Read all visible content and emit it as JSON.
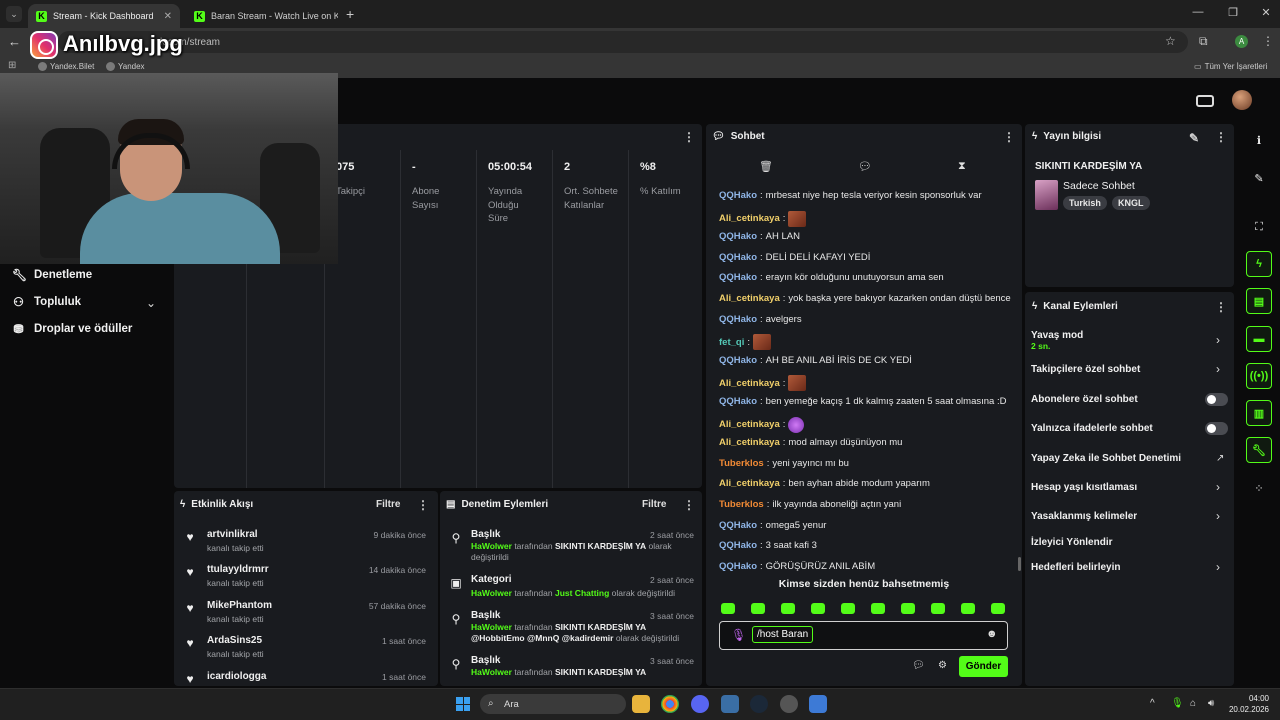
{
  "browser": {
    "tabs": [
      {
        "title": "Stream - Kick Dashboard",
        "active": true
      },
      {
        "title": "Baran Stream - Watch Live on K",
        "active": false
      }
    ],
    "url": "k.com/stream",
    "bookmarks": [
      "Yandex.Bilet",
      "Yandex"
    ],
    "all_bookmarks": "Tüm Yer İşaretleri",
    "profile_initial": "A"
  },
  "overlay": {
    "watermark": "Anılbvg.jpg"
  },
  "nav": {
    "items": [
      {
        "label": "Denetleme",
        "icon": "wrench-icon"
      },
      {
        "label": "Topluluk",
        "icon": "community-icon"
      },
      {
        "label": "Droplar ve ödüller",
        "icon": "gift-icon"
      }
    ]
  },
  "stats": [
    {
      "value": "075",
      "label": "Takipçi"
    },
    {
      "value": "-",
      "label": "Abone Sayısı"
    },
    {
      "value": "05:00:54",
      "label": "Yayında Olduğu Süre"
    },
    {
      "value": "2",
      "label": "Ort. Sohbete Katılanlar"
    },
    {
      "value": "%8",
      "label": "% Katılım"
    }
  ],
  "activity": {
    "title": "Etkinlik Akışı",
    "filter": "Filtre",
    "items": [
      {
        "name": "artvinlikral",
        "sub": "kanalı takip etti",
        "time": "9 dakika önce"
      },
      {
        "name": "ttulayyldrmrr",
        "sub": "kanalı takip etti",
        "time": "14 dakika önce"
      },
      {
        "name": "MikePhantom",
        "sub": "kanalı takip etti",
        "time": "57 dakika önce"
      },
      {
        "name": "ArdaSins25",
        "sub": "kanalı takip etti",
        "time": "1 saat önce"
      },
      {
        "name": "icardiologga",
        "sub": "",
        "time": "1 saat önce"
      }
    ]
  },
  "moderation": {
    "title": "Denetim Eylemleri",
    "filter": "Filtre",
    "items": [
      {
        "title": "Başlık",
        "time": "2 saat önce",
        "user": "HaWolwer",
        "mid": "tarafından",
        "value": "SIKINTI KARDEŞİM YA",
        "end": "olarak değiştirildi"
      },
      {
        "title": "Kategori",
        "time": "2 saat önce",
        "user": "HaWolwer",
        "mid": "tarafından",
        "value": "Just Chatting",
        "end": "olarak değiştirildi"
      },
      {
        "title": "Başlık",
        "time": "3 saat önce",
        "user": "HaWolwer",
        "mid": "tarafından",
        "value": "SIKINTI KARDEŞİM YA @HobbitEmo @MnnQ @kadirdemir",
        "end": "olarak değiştirildi"
      },
      {
        "title": "Başlık",
        "time": "3 saat önce",
        "user": "HaWolwer",
        "mid": "tarafından",
        "value": "SIKINTI KARDEŞİM YA",
        "end": ""
      }
    ]
  },
  "chat": {
    "title": "Sohbet",
    "messages": [
      {
        "user": "QQHako",
        "color": "blue",
        "text": "mrbesat niye hep tesla veriyor kesin sponsorluk var"
      },
      {
        "user": "Ali_cetinkaya",
        "color": "gold",
        "text": "",
        "emote": "face"
      },
      {
        "user": "QQHako",
        "color": "blue",
        "text": "AH LAN"
      },
      {
        "user": "QQHako",
        "color": "blue",
        "text": "DELİ DELİ KAFAYI YEDİ"
      },
      {
        "user": "QQHako",
        "color": "blue",
        "text": "erayın kör olduğunu unutuyorsun ama sen"
      },
      {
        "user": "Ali_cetinkaya",
        "color": "gold",
        "text": "yok başka yere bakıyor kazarken ondan düştü bence"
      },
      {
        "user": "QQHako",
        "color": "blue",
        "text": "avelgers"
      },
      {
        "user": "fet_qi",
        "color": "teal",
        "text": "",
        "emote": "face"
      },
      {
        "user": "QQHako",
        "color": "blue",
        "text": "AH BE ANIL ABİ İRİS DE CK YEDİ"
      },
      {
        "user": "Ali_cetinkaya",
        "color": "gold",
        "text": "",
        "emote": "face"
      },
      {
        "user": "QQHako",
        "color": "blue",
        "text": "ben yemeğe kaçış 1 dk kalmış zaaten 5 saat olmasına :D"
      },
      {
        "user": "Ali_cetinkaya",
        "color": "gold",
        "text": "",
        "emote": "purple"
      },
      {
        "user": "Ali_cetinkaya",
        "color": "gold",
        "text": "mod almayı düşünüyon mu"
      },
      {
        "user": "Tuberklos",
        "color": "orange",
        "text": "yeni yayıncı mı bu"
      },
      {
        "user": "Ali_cetinkaya",
        "color": "gold",
        "text": "ben ayhan abide modum yaparım"
      },
      {
        "user": "Tuberklos",
        "color": "orange",
        "text": "ilk yayında aboneliği açtın yani"
      },
      {
        "user": "QQHako",
        "color": "blue",
        "text": "omega5 yenur"
      },
      {
        "user": "QQHako",
        "color": "blue",
        "text": "3 saat kafi 3"
      },
      {
        "user": "QQHako",
        "color": "blue",
        "text": "GÖRÜŞÜRÜZ ANIL ABİM"
      }
    ],
    "mention_notice": "Kimse sizden henüz bahsetmemiş",
    "input_value": "/host Baran",
    "send_label": "Gönder"
  },
  "stream_info": {
    "title": "Yayın bilgisi",
    "stream_title": "SIKINTI KARDEŞİM YA",
    "category": "Sadece Sohbet",
    "tags": [
      "Turkish",
      "KNGL"
    ]
  },
  "channel_actions": {
    "title": "Kanal Eylemleri",
    "slow_mode": {
      "label": "Yavaş mod",
      "value": "2 sn."
    },
    "followers_only": "Takipçilere özel sohbet",
    "subscribers_only": "Abonelere özel sohbet",
    "emotes_only": "Yalnızca ifadelerle sohbet",
    "ai_moderation": "Yapay Zeka ile Sohbet Denetimi",
    "account_age": "Hesap yaşı kısıtlaması",
    "banned_words": "Yasaklanmış kelimeler",
    "redirect": "İzleyici Yönlendir",
    "targets": "Hedefleri belirleyin"
  },
  "taskbar": {
    "search_label": "Ara",
    "time": "04:00",
    "date": "20.02.2026"
  },
  "colors": {
    "accent": "#53fc18",
    "panel": "#191b1f",
    "background": "#0b0b0c"
  }
}
